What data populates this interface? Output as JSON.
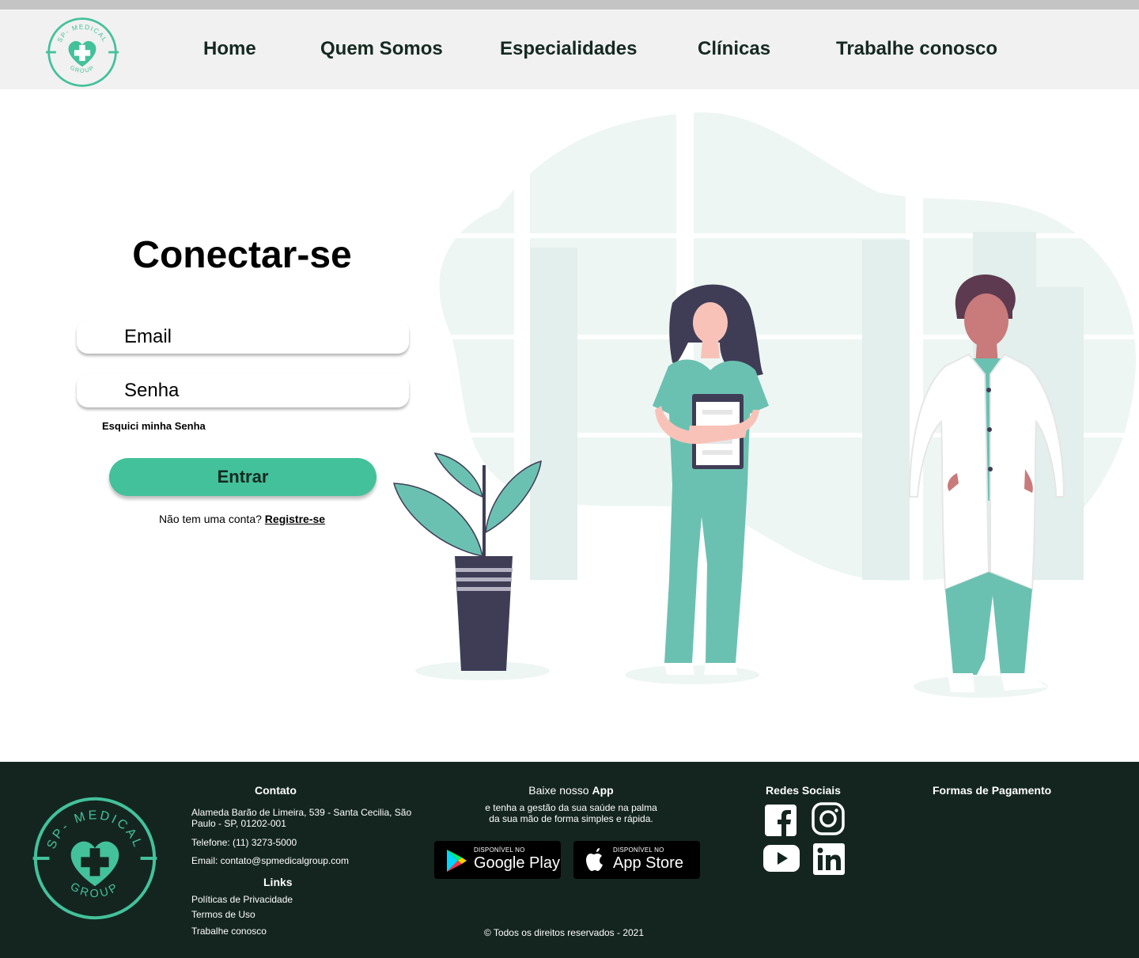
{
  "brand": {
    "logo_top_text": "SP- MEDICAL",
    "logo_bottom_text": "GROUP",
    "primary_color": "#43c19a",
    "dark_color": "#142520"
  },
  "nav": {
    "items": [
      "Home",
      "Quem Somos",
      "Especialidades",
      "Clínicas",
      "Trabalhe conosco"
    ]
  },
  "login": {
    "title": "Conectar-se",
    "email_placeholder": "Email",
    "password_placeholder": "Senha",
    "forgot_password": "Esquici minha Senha",
    "submit_label": "Entrar",
    "no_account_text": "Não tem uma conta?",
    "register_link": "Registre-se"
  },
  "footer": {
    "contact": {
      "heading": "Contato",
      "address_line1": "Alameda Barão de Limeira, 539 - Santa Cecilia, São",
      "address_line2": "Paulo - SP, 01202-001",
      "phone": "Telefone: (11) 3273-5000",
      "email": "Email: contato@spmedicalgroup.com"
    },
    "links": {
      "heading": "Links",
      "items": [
        "Políticas de Privacidade",
        "Termos de Uso",
        "Trabalhe conosco"
      ]
    },
    "app": {
      "heading_prefix": "Baixe nosso",
      "heading_bold": "App",
      "line1": "e tenha a gestão da sua saúde na palma",
      "line2": "da sua mão de forma simples e rápida.",
      "google_small": "DISPONÍVEL NO",
      "google_big": "Google Play",
      "apple_small": "DISPONÍVEL NO",
      "apple_big": "App Store"
    },
    "social": {
      "heading": "Redes Sociais",
      "icons": [
        "facebook-icon",
        "instagram-icon",
        "youtube-icon",
        "linkedin-icon"
      ]
    },
    "payment": {
      "heading": "Formas de Pagamento"
    },
    "copyright": "© Todos os direitos reservados - 2021"
  }
}
